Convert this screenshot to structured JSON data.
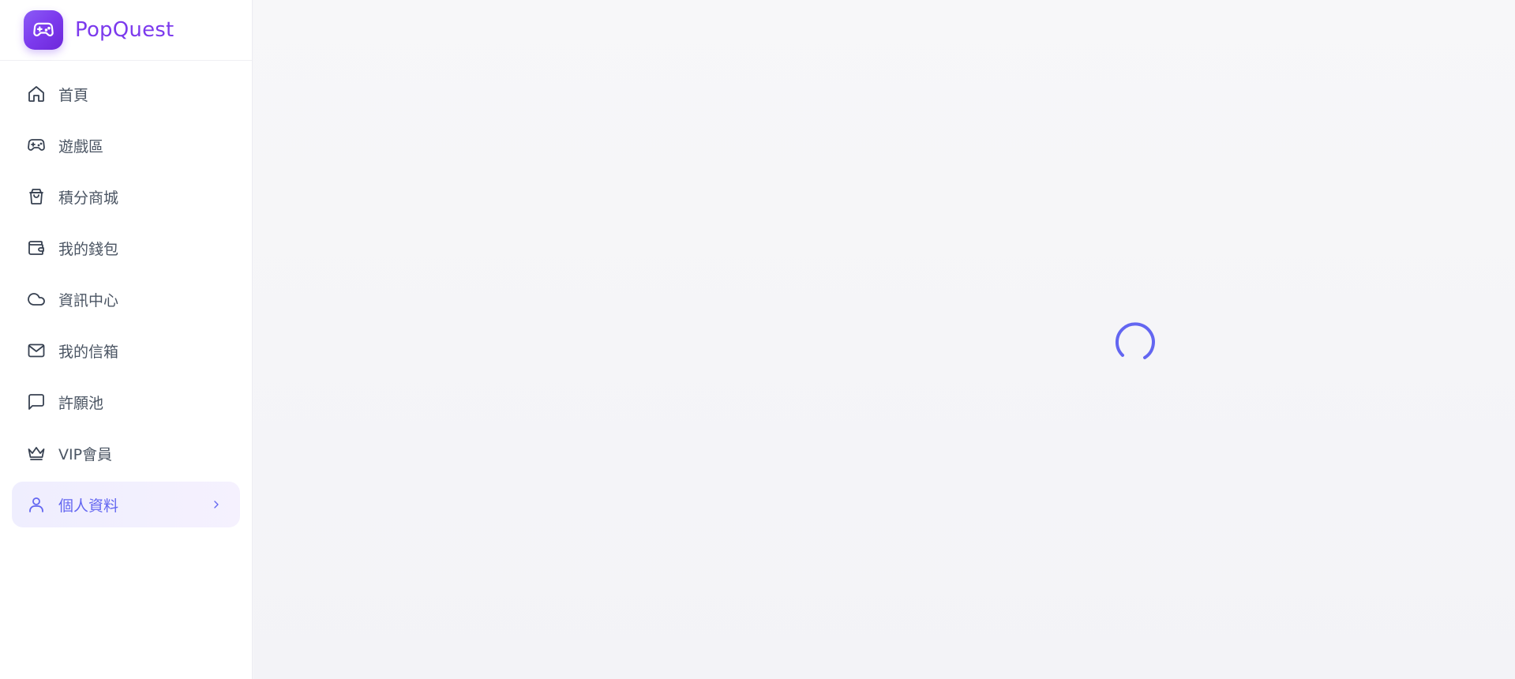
{
  "brand": {
    "name": "PopQuest",
    "logo_icon": "gamepad-icon",
    "accent_color": "#7c3aed"
  },
  "sidebar": {
    "items": [
      {
        "label": "首頁",
        "icon": "home-icon"
      },
      {
        "label": "遊戲區",
        "icon": "gamepad-icon"
      },
      {
        "label": "積分商城",
        "icon": "shopping-bag-icon"
      },
      {
        "label": "我的錢包",
        "icon": "wallet-icon"
      },
      {
        "label": "資訊中心",
        "icon": "cloud-icon"
      },
      {
        "label": "我的信箱",
        "icon": "mail-icon"
      },
      {
        "label": "許願池",
        "icon": "message-square-icon"
      },
      {
        "label": "VIP會員",
        "icon": "crown-icon"
      },
      {
        "label": "個人資料",
        "icon": "user-icon",
        "active": true
      }
    ],
    "active_color": "#6366f1"
  },
  "main": {
    "state": "loading",
    "spinner_icon": "loading-spinner-icon"
  }
}
